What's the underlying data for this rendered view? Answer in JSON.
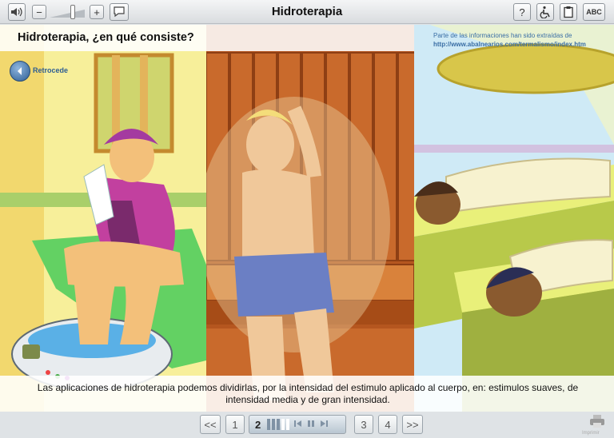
{
  "toolbar": {
    "title": "Hidroterapia",
    "sound_icon": "speaker-icon",
    "minus": "−",
    "plus": "+",
    "volume_level": 0.6,
    "help": "?",
    "abc": "ABC"
  },
  "content": {
    "heading": "Hidroterapia, ¿en qué consiste?",
    "source_line1": "Parte de las informaciones han sido extraídas de",
    "source_url": "http://www.abalnearios.com/termalismo/index.htm",
    "back_label": "Retrocede",
    "caption": "Las aplicaciones de hidroterapia podemos dividirlas, por la intensidad del estimulo aplicado al cuerpo, en: estimulos suaves, de intensidad media y de gran intensidad."
  },
  "pager": {
    "first": "<<",
    "pages": [
      "1",
      "2",
      "3",
      "4"
    ],
    "current": "2",
    "last": ">>",
    "print_label": "Imprimir"
  },
  "colors": {
    "panel_bath": "#f7ef9a",
    "panel_sauna": "#b5561f",
    "panel_spa": "#cfeaf6",
    "link": "#3a6ea5"
  }
}
